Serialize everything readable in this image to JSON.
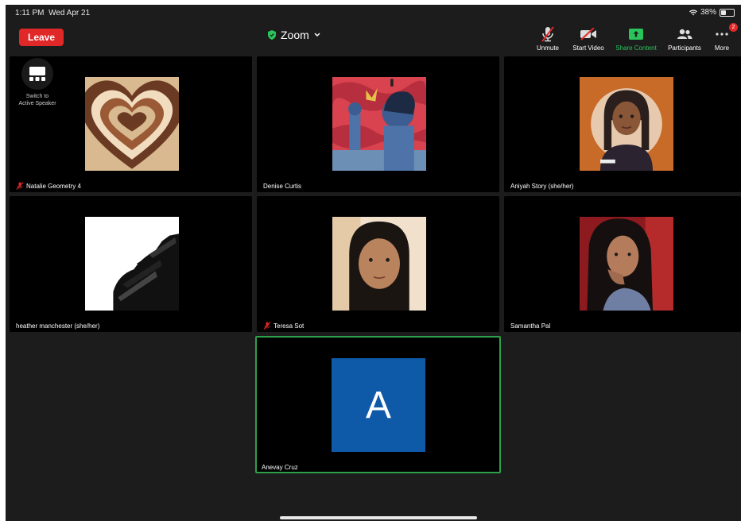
{
  "status_bar": {
    "time": "1:11 PM",
    "date": "Wed Apr 21",
    "battery": "38%",
    "battery_level": 0.38
  },
  "header": {
    "leave_label": "Leave",
    "meeting_title": "Zoom",
    "controls": [
      {
        "label": "Unmute",
        "icon": "mic-muted-icon"
      },
      {
        "label": "Start Video",
        "icon": "video-off-icon"
      },
      {
        "label": "Share Content",
        "icon": "share-content-icon",
        "color": "#29c45a"
      },
      {
        "label": "Participants",
        "icon": "participants-icon"
      },
      {
        "label": "More",
        "icon": "more-icon",
        "badge": "2"
      }
    ]
  },
  "switch_view": {
    "line1": "Switch to",
    "line2": "Active Speaker"
  },
  "participants": [
    {
      "name": "Natalie Geometry 4",
      "muted": true,
      "avatar": "heart-pattern-image"
    },
    {
      "name": "Denise Curtis",
      "muted": false,
      "avatar": "mural-image"
    },
    {
      "name": "Aniyah Story (she/her)",
      "muted": false,
      "avatar": "illustration-portrait-image"
    },
    {
      "name": "heather manchester (she/her)",
      "muted": false,
      "avatar": "abstract-bw-image"
    },
    {
      "name": "Teresa Sot",
      "muted": true,
      "avatar": "photo-portrait-image"
    },
    {
      "name": "Samantha Pal",
      "muted": false,
      "avatar": "photo-portrait-image"
    },
    {
      "name": "Anevay Cruz",
      "muted": false,
      "avatar_letter": "A",
      "active_speaker": true
    }
  ],
  "colors": {
    "leave": "#e02828",
    "accent_green": "#29c45a",
    "active_border": "#2ea04a",
    "avatar_blue": "#0e5aa8"
  }
}
